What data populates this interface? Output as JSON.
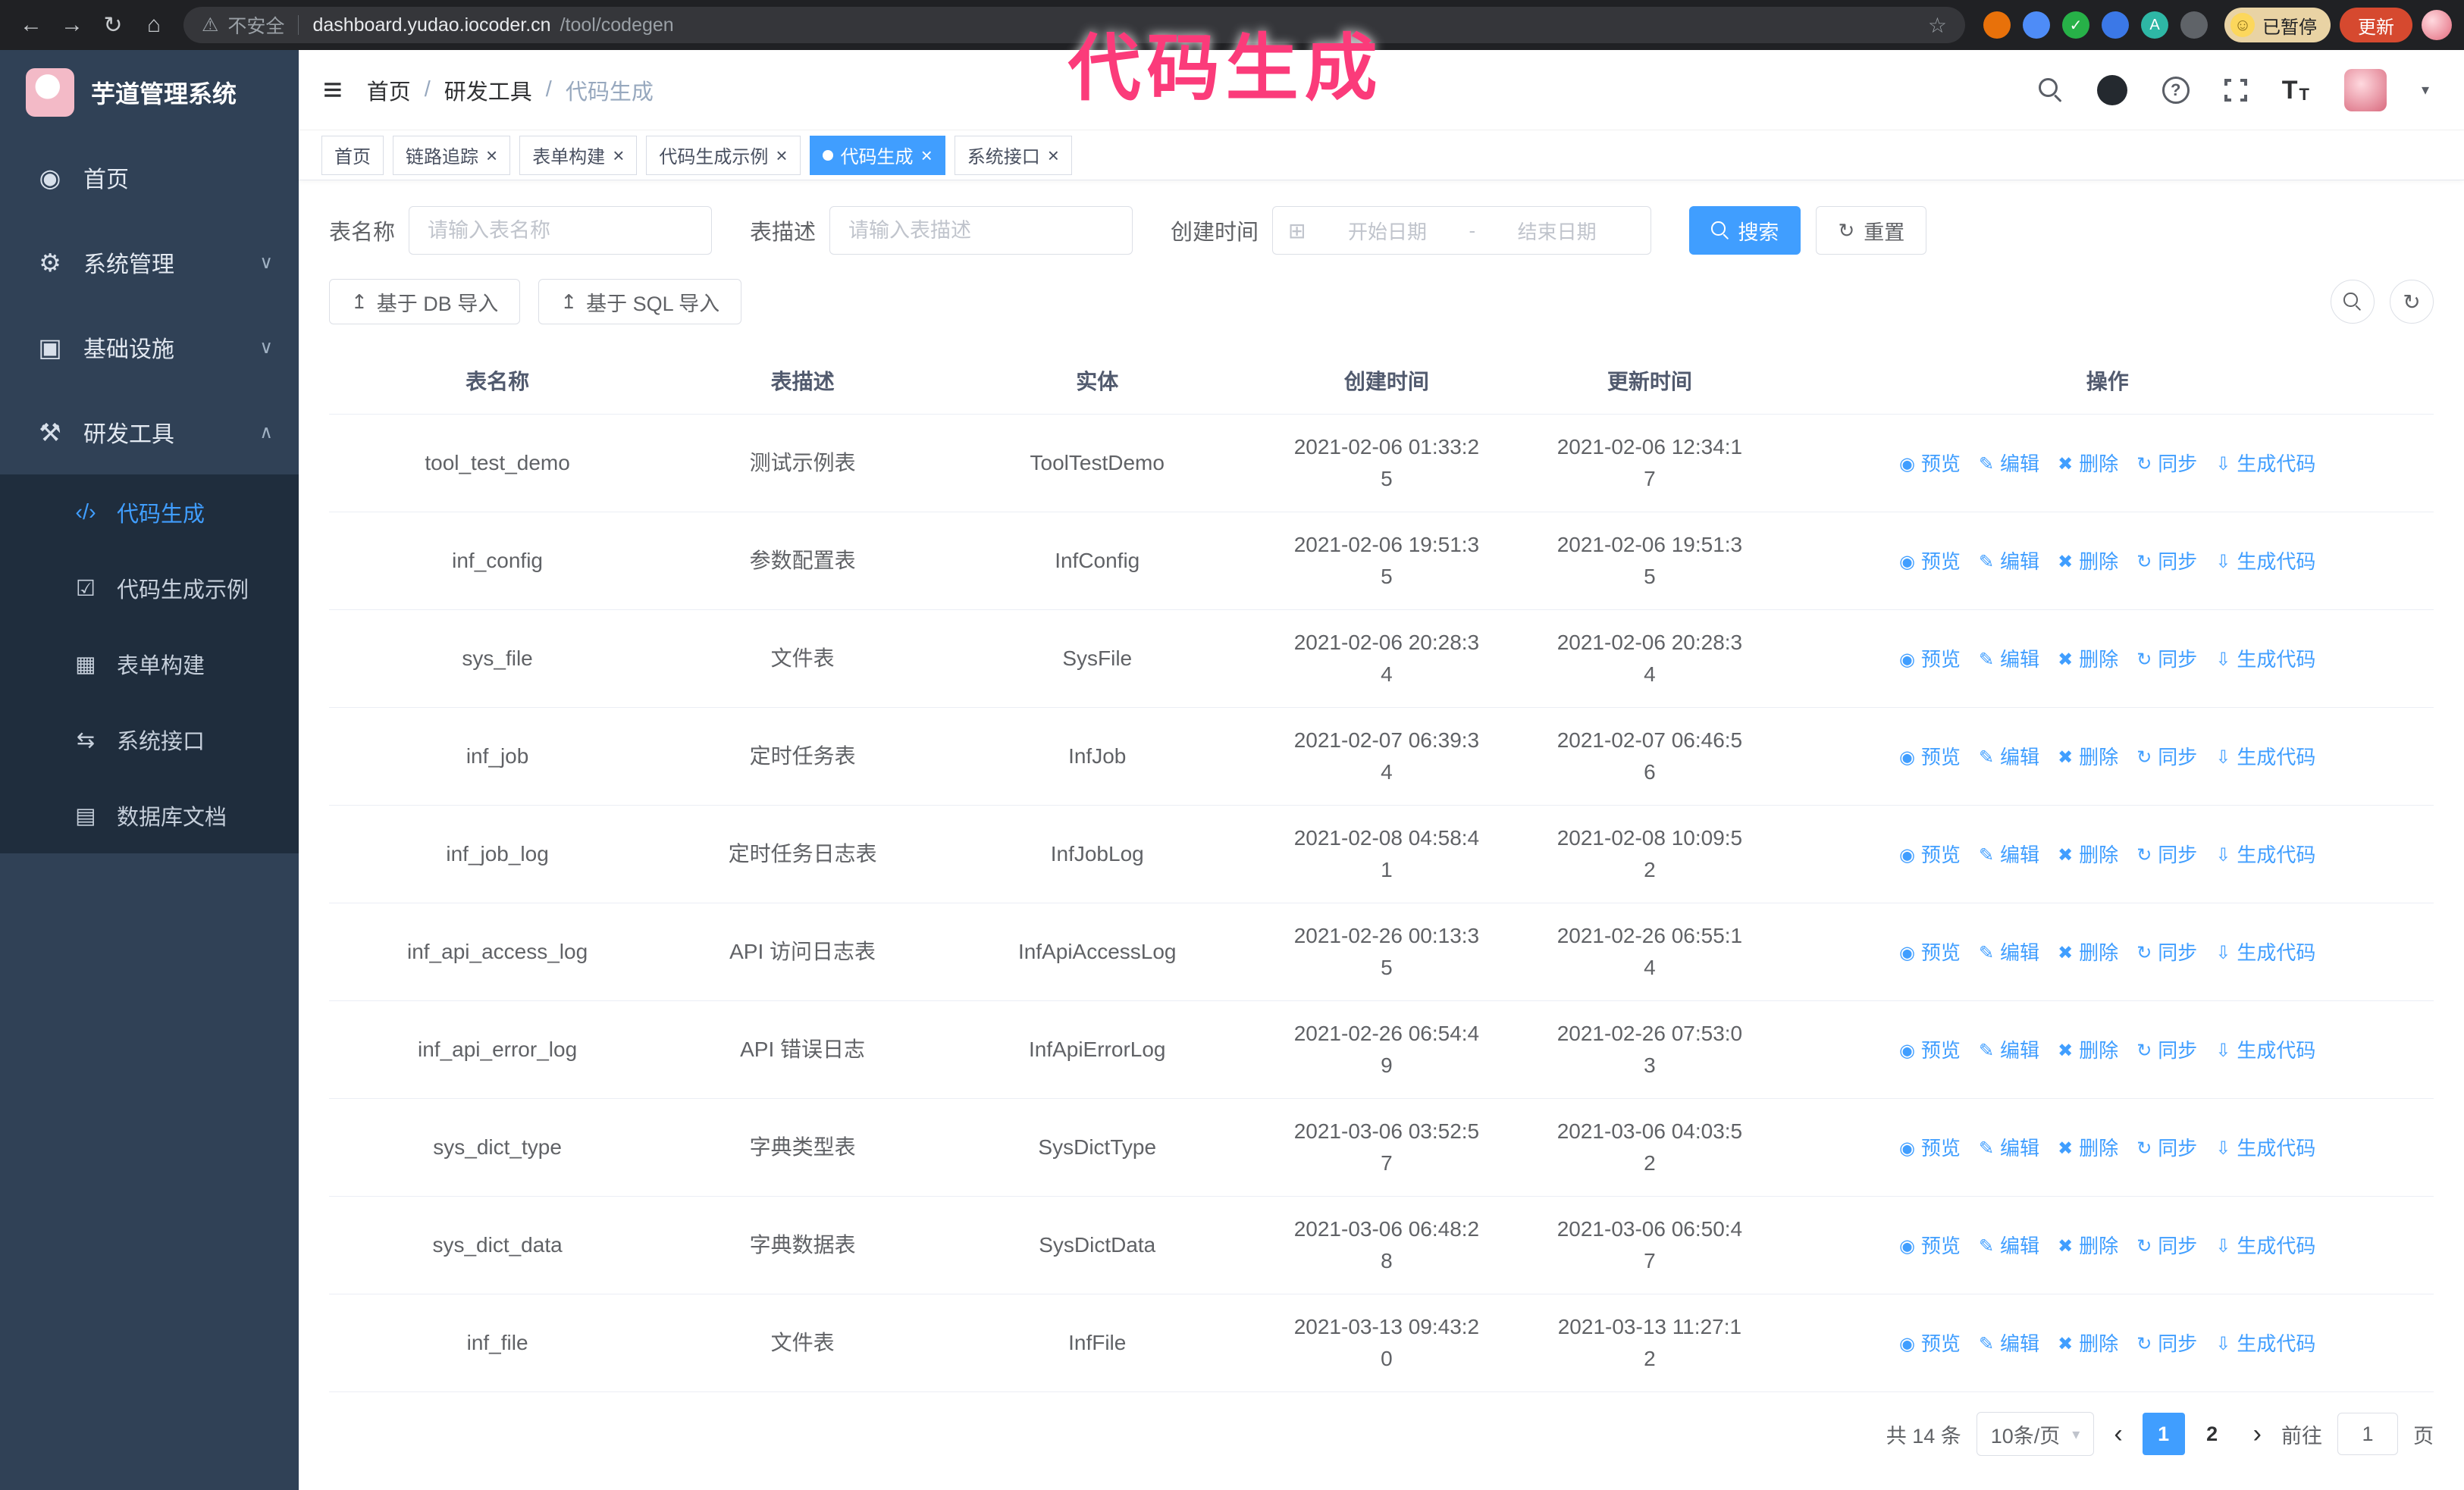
{
  "colors": {
    "accent_blue": "#409eff",
    "sidebar_bg": "#304156",
    "submenu_bg": "#1f2d3d",
    "overlay_pink": "#fb3b7a",
    "chrome_bg": "#202124",
    "update_button_bg": "#d6492f"
  },
  "icons": {
    "back": "←",
    "forward": "→",
    "reload": "↻",
    "home": "⌂",
    "warning": "⚠",
    "star": "☆",
    "smiley": "☺",
    "hamburger": "≡",
    "question": "?",
    "caret_down": "▾",
    "chevron_down": "∨",
    "chevron_up": "∧",
    "calendar": "⊞",
    "refresh": "↻",
    "upload": "↥",
    "close": "×",
    "prev": "‹",
    "next": "›",
    "font_size_large": "T",
    "font_size_small": "T"
  },
  "overlay": {
    "text": "代码生成"
  },
  "browser": {
    "security_label": "不安全",
    "url_host": "dashboard.yudao.iocoder.cn",
    "url_path": "/tool/codegen",
    "profile_badge": "已暂停",
    "update_button": "更新",
    "extensions": [
      {
        "name": "extension-orange-icon",
        "color": "#e8710a",
        "glyph": ""
      },
      {
        "name": "extension-blue-drop-icon",
        "color": "#4e8cf7",
        "glyph": ""
      },
      {
        "name": "extension-green-check-icon",
        "color": "#27b148",
        "glyph": "✓"
      },
      {
        "name": "extension-people-icon",
        "color": "#3b78e7",
        "glyph": ""
      },
      {
        "name": "extension-translate-icon",
        "color": "#2eb7a5",
        "glyph": "A"
      },
      {
        "name": "extension-puzzle-icon",
        "color": "#5f6368",
        "glyph": ""
      }
    ]
  },
  "sidebar": {
    "logo_title": "芋道管理系统",
    "items": [
      {
        "id": "home",
        "label": "首页",
        "icon": "dashboard-icon",
        "glyph": "◉"
      },
      {
        "id": "system",
        "label": "系统管理",
        "icon": "gear-icon",
        "glyph": "⚙",
        "chevron": "down"
      },
      {
        "id": "infra",
        "label": "基础设施",
        "icon": "infrastructure-icon",
        "glyph": "▣",
        "chevron": "down"
      },
      {
        "id": "devtools",
        "label": "研发工具",
        "icon": "tools-icon",
        "glyph": "⚒",
        "chevron": "up",
        "expanded": true
      }
    ],
    "submenu": [
      {
        "id": "codegen",
        "label": "代码生成",
        "icon": "code-icon",
        "glyph": "‹/›",
        "active": true
      },
      {
        "id": "codegen-example",
        "label": "代码生成示例",
        "icon": "example-icon",
        "glyph": "☑"
      },
      {
        "id": "form-builder",
        "label": "表单构建",
        "icon": "form-icon",
        "glyph": "▦"
      },
      {
        "id": "api",
        "label": "系统接口",
        "icon": "api-icon",
        "glyph": "⇆"
      },
      {
        "id": "db-doc",
        "label": "数据库文档",
        "icon": "database-icon",
        "glyph": "▤"
      }
    ]
  },
  "header": {
    "breadcrumb": [
      "首页",
      "研发工具",
      "代码生成"
    ]
  },
  "tabs": [
    {
      "label": "首页",
      "closable": false,
      "active": false
    },
    {
      "label": "链路追踪",
      "closable": true,
      "active": false
    },
    {
      "label": "表单构建",
      "closable": true,
      "active": false
    },
    {
      "label": "代码生成示例",
      "closable": true,
      "active": false
    },
    {
      "label": "代码生成",
      "closable": true,
      "active": true
    },
    {
      "label": "系统接口",
      "closable": true,
      "active": false
    }
  ],
  "search_form": {
    "table_name_label": "表名称",
    "table_name_placeholder": "请输入表名称",
    "table_desc_label": "表描述",
    "table_desc_placeholder": "请输入表描述",
    "create_time_label": "创建时间",
    "date_start_placeholder": "开始日期",
    "date_separator": "-",
    "date_end_placeholder": "结束日期",
    "search_button": "搜索",
    "reset_button": "重置"
  },
  "toolbar": {
    "import_db_button": "基于 DB 导入",
    "import_sql_button": "基于 SQL 导入"
  },
  "table": {
    "columns": [
      "表名称",
      "表描述",
      "实体",
      "创建时间",
      "更新时间",
      "操作"
    ],
    "actions": [
      {
        "id": "preview",
        "label": "预览",
        "icon": "preview-eye",
        "glyph": "◉"
      },
      {
        "id": "edit",
        "label": "编辑",
        "icon": "edit-pencil",
        "glyph": "✎"
      },
      {
        "id": "delete",
        "label": "删除",
        "icon": "delete-trash",
        "glyph": "✖"
      },
      {
        "id": "sync",
        "label": "同步",
        "icon": "sync-refresh",
        "glyph": "↻"
      },
      {
        "id": "generate",
        "label": "生成代码",
        "icon": "generate-code-download",
        "glyph": "⇩"
      }
    ],
    "rows": [
      {
        "name": "tool_test_demo",
        "desc": "测试示例表",
        "entity": "ToolTestDemo",
        "create_time": "2021-02-06 01:33:25",
        "update_time": "2021-02-06 12:34:17"
      },
      {
        "name": "inf_config",
        "desc": "参数配置表",
        "entity": "InfConfig",
        "create_time": "2021-02-06 19:51:35",
        "update_time": "2021-02-06 19:51:35"
      },
      {
        "name": "sys_file",
        "desc": "文件表",
        "entity": "SysFile",
        "create_time": "2021-02-06 20:28:34",
        "update_time": "2021-02-06 20:28:34"
      },
      {
        "name": "inf_job",
        "desc": "定时任务表",
        "entity": "InfJob",
        "create_time": "2021-02-07 06:39:34",
        "update_time": "2021-02-07 06:46:56"
      },
      {
        "name": "inf_job_log",
        "desc": "定时任务日志表",
        "entity": "InfJobLog",
        "create_time": "2021-02-08 04:58:41",
        "update_time": "2021-02-08 10:09:52"
      },
      {
        "name": "inf_api_access_log",
        "desc": "API 访问日志表",
        "entity": "InfApiAccessLog",
        "create_time": "2021-02-26 00:13:35",
        "update_time": "2021-02-26 06:55:14"
      },
      {
        "name": "inf_api_error_log",
        "desc": "API 错误日志",
        "entity": "InfApiErrorLog",
        "create_time": "2021-02-26 06:54:49",
        "update_time": "2021-02-26 07:53:03"
      },
      {
        "name": "sys_dict_type",
        "desc": "字典类型表",
        "entity": "SysDictType",
        "create_time": "2021-03-06 03:52:57",
        "update_time": "2021-03-06 04:03:52"
      },
      {
        "name": "sys_dict_data",
        "desc": "字典数据表",
        "entity": "SysDictData",
        "create_time": "2021-03-06 06:48:28",
        "update_time": "2021-03-06 06:50:47"
      },
      {
        "name": "inf_file",
        "desc": "文件表",
        "entity": "InfFile",
        "create_time": "2021-03-13 09:43:20",
        "update_time": "2021-03-13 11:27:12"
      }
    ]
  },
  "pagination": {
    "total_text": "共 14 条",
    "page_size": "10条/页",
    "pages": [
      "1",
      "2"
    ],
    "active_page": "1",
    "goto_label": "前往",
    "goto_value": "1",
    "goto_unit": "页"
  }
}
